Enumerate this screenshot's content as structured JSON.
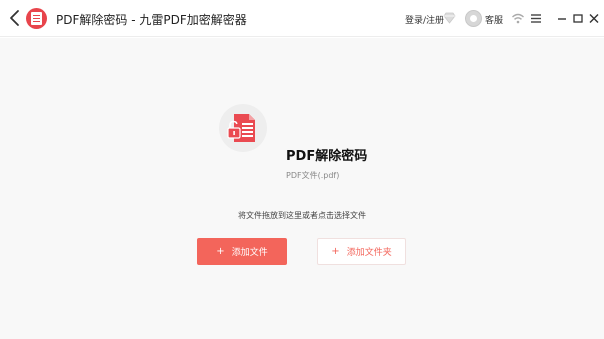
{
  "window": {
    "title": "PDF解除密码 - 九雷PDF加密解密器",
    "login_label": "登录/注册",
    "service_label": "客服",
    "accent_color": "#f3655b",
    "logo_color": "#e8454c"
  },
  "main": {
    "tool_title": "PDF解除密码",
    "tool_subtitle": "PDF文件(.pdf)",
    "hint": "将文件拖放到这里或者点击选择文件",
    "add_file_button": "添加文件",
    "add_folder_button": "添加文件夹",
    "plus_symbol": "+"
  },
  "icons": [
    "back-icon",
    "app-logo-icon",
    "vip-diamond-icon",
    "customer-service-avatar-icon",
    "wifi-icon",
    "menu-icon",
    "minimize-icon",
    "maximize-icon",
    "close-icon",
    "pdf-unlock-icon"
  ]
}
